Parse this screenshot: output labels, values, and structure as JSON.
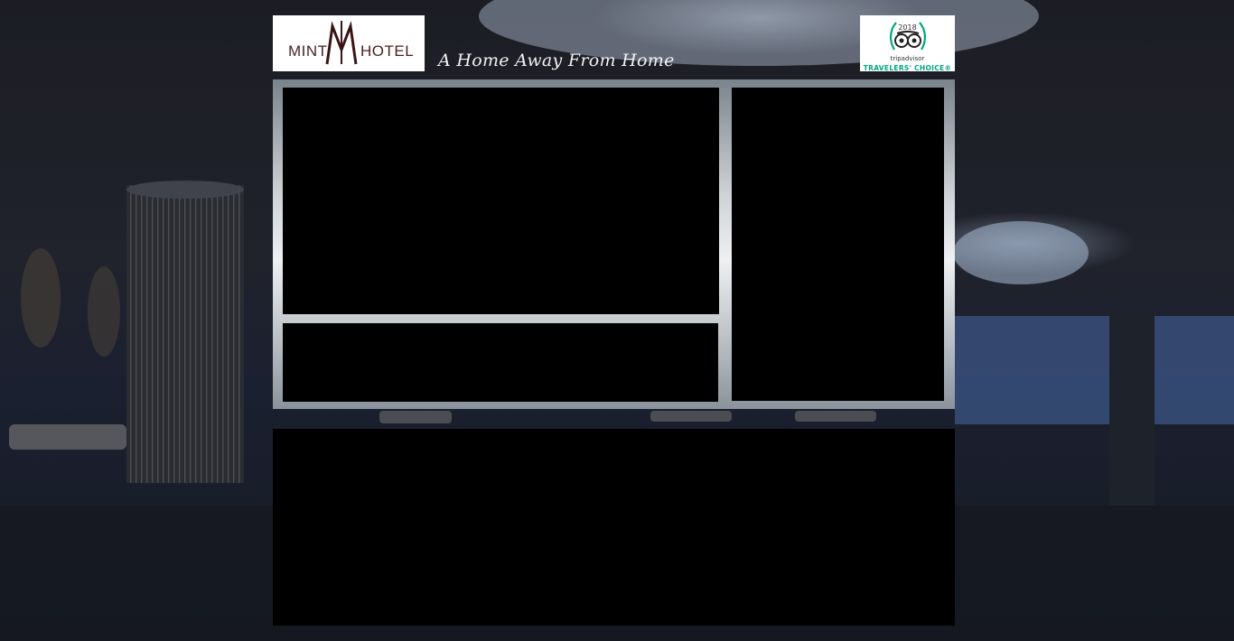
{
  "header": {
    "logo": {
      "word_left": "MINT",
      "word_right": "HOTEL",
      "brand_color": "#4a1f1f"
    },
    "tagline": "A Home Away From Home",
    "award": {
      "year": "2018",
      "brand": "tripadvisor",
      "title": "TRAVELERS' CHOICE®",
      "accent_color": "#00a680",
      "icon": "tripadvisor-owl-icon"
    }
  },
  "content": {
    "panel_color": "#000000",
    "frame_color": "#c9ced3"
  }
}
